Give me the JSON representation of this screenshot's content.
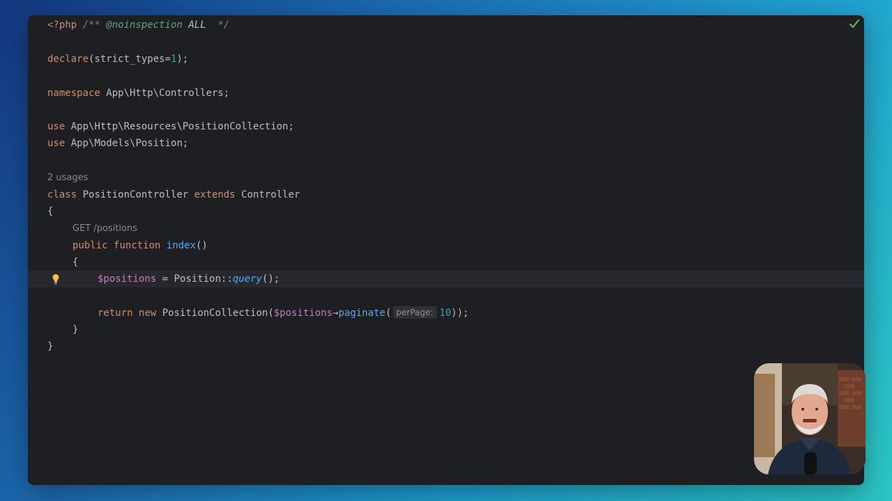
{
  "editor": {
    "line1": {
      "php_tag": "<?php",
      "comment_open": "/**",
      "annotation": "@noinspection",
      "annotation_arg": "ALL",
      "comment_close": "*/"
    },
    "line2": {
      "declare": "declare",
      "arg": "(strict_types=",
      "value": "1",
      "end": ");"
    },
    "line3": {
      "keyword": "namespace",
      "name": " App\\Http\\Controllers;"
    },
    "line4": {
      "keyword": "use",
      "name": " App\\Http\\Resources\\PositionCollection;"
    },
    "line5": {
      "keyword": "use",
      "name": " App\\Models\\Position;"
    },
    "usages_hint": "2 usages",
    "line6": {
      "kw_class": "class",
      "class_name": " PositionController ",
      "kw_extends": "extends",
      "parent": " Controller"
    },
    "brace_open": "{",
    "route_hint": "GET /positions",
    "line8": {
      "kw_public": "public",
      "kw_function": "function",
      "method": "index",
      "parens": "()"
    },
    "method_brace_open": "{",
    "line10": {
      "var": "$positions",
      "assign": " = Position::",
      "call": "query",
      "end": "();"
    },
    "line12": {
      "kw_return": "return",
      "kw_new": "new",
      "cls": " PositionCollection(",
      "var": "$positions",
      "arrow": "→",
      "method": "paginate",
      "paren": "(",
      "param_hint": "perPage:",
      "value": "10",
      "end": "));"
    },
    "method_brace_close": "}",
    "brace_close": "}"
  },
  "colors": {
    "keyword": "#cf8e6d",
    "number": "#2aacb8",
    "variable": "#c77dbb",
    "function": "#56a8f5",
    "comment_tag": "#67a37c",
    "text": "#bcbec4"
  },
  "icons": {
    "status": "green-check-icon",
    "intention": "lightbulb-icon",
    "webcam": "presenter-video"
  }
}
